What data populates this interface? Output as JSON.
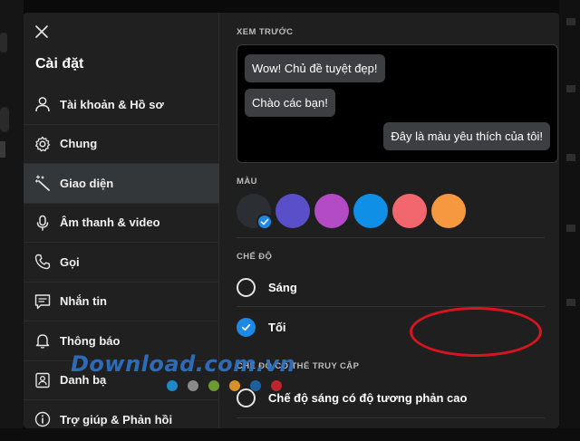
{
  "sidebar": {
    "title": "Cài đặt",
    "items": [
      {
        "label": "Tài khoản & Hồ sơ",
        "icon": "person-icon"
      },
      {
        "label": "Chung",
        "icon": "gear-icon"
      },
      {
        "label": "Giao diện",
        "icon": "magic-wand-icon",
        "active": true
      },
      {
        "label": "Âm thanh & video",
        "icon": "microphone-icon"
      },
      {
        "label": "Gọi",
        "icon": "phone-icon"
      },
      {
        "label": "Nhắn tin",
        "icon": "chat-icon"
      },
      {
        "label": "Thông báo",
        "icon": "bell-icon"
      },
      {
        "label": "Danh bạ",
        "icon": "contacts-icon"
      },
      {
        "label": "Trợ giúp & Phản hồi",
        "icon": "info-icon"
      }
    ]
  },
  "preview": {
    "label": "XEM TRƯỚC",
    "messages": [
      {
        "text": "Wow! Chủ đề tuyệt đẹp!",
        "side": "left"
      },
      {
        "text": "Chào các bạn!",
        "side": "left"
      },
      {
        "text": "Đây là màu yêu thích của tôi!",
        "side": "right"
      }
    ]
  },
  "color": {
    "label": "MÀU",
    "swatches": [
      "#2b2e33",
      "#5a4fc8",
      "#b44bc6",
      "#0f8fe6",
      "#f2676d",
      "#f5983f"
    ],
    "selected_index": 0
  },
  "mode": {
    "label": "CHẾ ĐỘ",
    "options": [
      {
        "label": "Sáng",
        "checked": false
      },
      {
        "label": "Tối",
        "checked": true
      }
    ]
  },
  "accessibility": {
    "label": "CHẾ ĐỘ CÓ THỂ TRUY CẬP",
    "options": [
      {
        "label": "Chế độ sáng có độ tương phản cao",
        "checked": false
      }
    ]
  },
  "watermark": {
    "text": "Download.com.vn",
    "dot_colors": [
      "#1e88c8",
      "#8a8a8a",
      "#6a9a30",
      "#d8902a",
      "#1e5fa0",
      "#c0242c"
    ]
  },
  "colors": {
    "accent": "#1e88e5",
    "annotation": "#d8151f"
  }
}
